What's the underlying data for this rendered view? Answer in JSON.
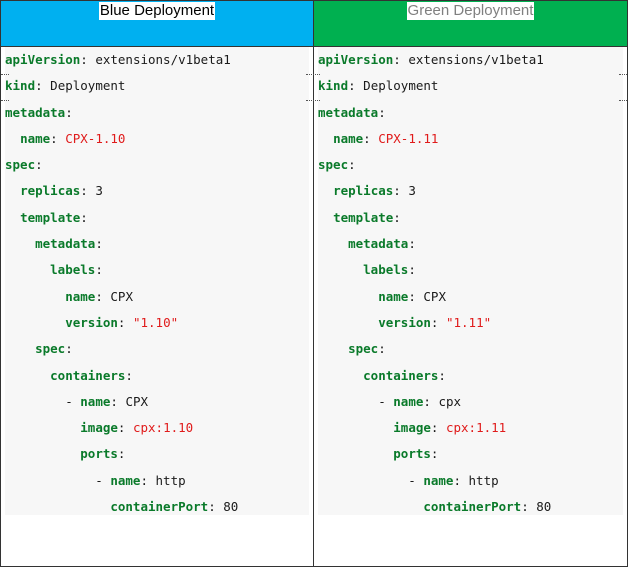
{
  "columns": [
    {
      "title": "Blue Deployment",
      "header_color": "#00b0f0",
      "lines": [
        {
          "indent": "",
          "key": "apiVersion",
          "sep": ": ",
          "value": "extensions/v1beta1",
          "value_red": false
        },
        {
          "indent": "",
          "key": "kind",
          "sep": ": ",
          "value": "Deployment",
          "value_red": false
        },
        {
          "indent": "",
          "key": "metadata",
          "sep": ":",
          "value": "",
          "value_red": false
        },
        {
          "indent": "  ",
          "key": "name",
          "sep": ": ",
          "value": "CPX-1.10",
          "value_red": true
        },
        {
          "indent": "",
          "key": "spec",
          "sep": ":",
          "value": "",
          "value_red": false
        },
        {
          "indent": "  ",
          "key": "replicas",
          "sep": ": ",
          "value": "3",
          "value_red": false
        },
        {
          "indent": "  ",
          "key": "template",
          "sep": ":",
          "value": "",
          "value_red": false
        },
        {
          "indent": "    ",
          "key": "metadata",
          "sep": ":",
          "value": "",
          "value_red": false
        },
        {
          "indent": "      ",
          "key": "labels",
          "sep": ":",
          "value": "",
          "value_red": false
        },
        {
          "indent": "        ",
          "key": "name",
          "sep": ": ",
          "value": "CPX",
          "value_red": false
        },
        {
          "indent": "        ",
          "key": "version",
          "sep": ": ",
          "value": "\"1.10\"",
          "value_red": true
        },
        {
          "indent": "    ",
          "key": "spec",
          "sep": ":",
          "value": "",
          "value_red": false
        },
        {
          "indent": "      ",
          "key": "containers",
          "sep": ":",
          "value": "",
          "value_red": false
        },
        {
          "indent": "        - ",
          "key": "name",
          "sep": ": ",
          "value": "CPX",
          "value_red": false
        },
        {
          "indent": "          ",
          "key": "image",
          "sep": ": ",
          "value": "cpx:1.10",
          "value_red": true
        },
        {
          "indent": "          ",
          "key": "ports",
          "sep": ":",
          "value": "",
          "value_red": false
        },
        {
          "indent": "            - ",
          "key": "name",
          "sep": ": ",
          "value": "http",
          "value_red": false
        },
        {
          "indent": "              ",
          "key": "containerPort",
          "sep": ": ",
          "value": "80",
          "value_red": false
        }
      ]
    },
    {
      "title": "Green Deployment",
      "header_color": "#00b050",
      "lines": [
        {
          "indent": "",
          "key": "apiVersion",
          "sep": ": ",
          "value": "extensions/v1beta1",
          "value_red": false
        },
        {
          "indent": "",
          "key": "kind",
          "sep": ": ",
          "value": "Deployment",
          "value_red": false
        },
        {
          "indent": "",
          "key": "metadata",
          "sep": ":",
          "value": "",
          "value_red": false
        },
        {
          "indent": "  ",
          "key": "name",
          "sep": ": ",
          "value": "CPX-1.11",
          "value_red": true
        },
        {
          "indent": "",
          "key": "spec",
          "sep": ":",
          "value": "",
          "value_red": false
        },
        {
          "indent": "  ",
          "key": "replicas",
          "sep": ": ",
          "value": "3",
          "value_red": false
        },
        {
          "indent": "  ",
          "key": "template",
          "sep": ":",
          "value": "",
          "value_red": false
        },
        {
          "indent": "    ",
          "key": "metadata",
          "sep": ":",
          "value": "",
          "value_red": false
        },
        {
          "indent": "      ",
          "key": "labels",
          "sep": ":",
          "value": "",
          "value_red": false
        },
        {
          "indent": "        ",
          "key": "name",
          "sep": ": ",
          "value": "CPX",
          "value_red": false
        },
        {
          "indent": "        ",
          "key": "version",
          "sep": ": ",
          "value": "\"1.11\"",
          "value_red": true
        },
        {
          "indent": "    ",
          "key": "spec",
          "sep": ":",
          "value": "",
          "value_red": false
        },
        {
          "indent": "      ",
          "key": "containers",
          "sep": ":",
          "value": "",
          "value_red": false
        },
        {
          "indent": "        - ",
          "key": "name",
          "sep": ": ",
          "value": "cpx",
          "value_red": false
        },
        {
          "indent": "          ",
          "key": "image",
          "sep": ": ",
          "value": "cpx:1.11",
          "value_red": true
        },
        {
          "indent": "          ",
          "key": "ports",
          "sep": ":",
          "value": "",
          "value_red": false
        },
        {
          "indent": "            - ",
          "key": "name",
          "sep": ": ",
          "value": "http",
          "value_red": false
        },
        {
          "indent": "              ",
          "key": "containerPort",
          "sep": ": ",
          "value": "80",
          "value_red": false
        }
      ]
    }
  ]
}
